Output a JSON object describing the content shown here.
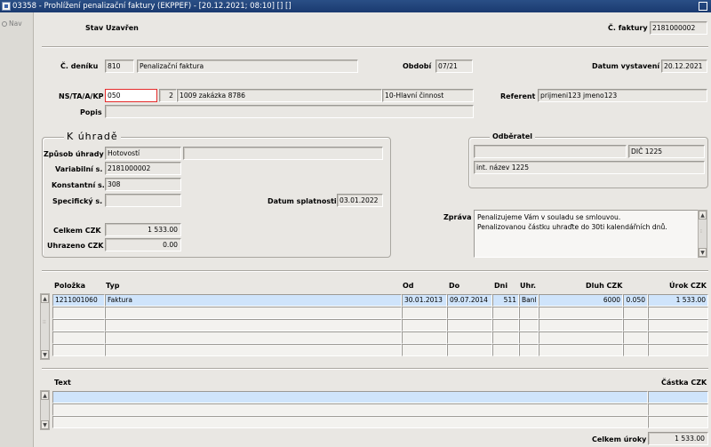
{
  "window": {
    "title": "03358 - Prohlížení penalizační faktury (EKPPEF) - [20.12.2021; 08:10] [] []"
  },
  "nav": {
    "label": "Nav"
  },
  "header": {
    "stav_label": "Stav",
    "stav_value": "Uzavřen",
    "cfaktury_label": "Č. faktury",
    "cfaktury_value": "2181000002"
  },
  "doc": {
    "cdeniku_label": "Č. deníku",
    "cdeniku_code": "810",
    "cdeniku_name": "Penalizační faktura",
    "obdobi_label": "Období",
    "obdobi_value": "07/21",
    "datum_vyst_label": "Datum vystavení",
    "datum_vyst_value": "20.12.2021",
    "ns_label": "NS/TA/A/KP",
    "ns_value": "050",
    "ta_value": "2",
    "a_value": "1009 zakázka 8786",
    "kp_value": "10-Hlavní činnost",
    "referent_label": "Referent",
    "referent_value": "prijmeni123 jmeno123",
    "popis_label": "Popis",
    "popis_value": ""
  },
  "uhrada": {
    "title": "K úhradě",
    "zpusob_label": "Způsob úhrady",
    "zpusob_value": "Hotovostí",
    "zpusob_extra": "",
    "variabilni_label": "Variabilní s.",
    "variabilni_value": "2181000002",
    "konstantni_label": "Konstantní s.",
    "konstantni_value": "308",
    "specificky_label": "Specifický s.",
    "specificky_value": "",
    "splatnost_label": "Datum splatnosti",
    "splatnost_value": "03.01.2022",
    "celkem_label": "Celkem CZK",
    "celkem_value": "1 533.00",
    "uhrazeno_label": "Uhrazeno CZK",
    "uhrazeno_value": "0.00"
  },
  "odberatel": {
    "title": "Odběratel",
    "field1": "",
    "dic": "DIČ 1225",
    "int_nazev": "int. název 1225"
  },
  "zprava": {
    "label": "Zpráva",
    "line1": "Penalizujeme Vám v souladu se smlouvou.",
    "line2": "Penalizovanou částku uhraďte do 30ti kalendářních dnů."
  },
  "grid": {
    "headers": {
      "polozka": "Položka",
      "typ": "Typ",
      "od": "Od",
      "do": "Do",
      "dni": "Dni",
      "uhr": "Uhr.",
      "dluh": "Dluh CZK",
      "urok": "Úrok CZK"
    },
    "row1": {
      "polozka": "1211001060",
      "typ": "Faktura",
      "od": "30.01.2013",
      "do": "09.07.2014",
      "dni": "511",
      "uhr": "Banl",
      "dluh": "6000",
      "sazba": "0.050",
      "urok": "1 533.00"
    }
  },
  "texts": {
    "headers": {
      "text": "Text",
      "castka": "Částka CZK"
    },
    "celkem_label": "Celkem úroky",
    "celkem_value": "1 533.00"
  }
}
